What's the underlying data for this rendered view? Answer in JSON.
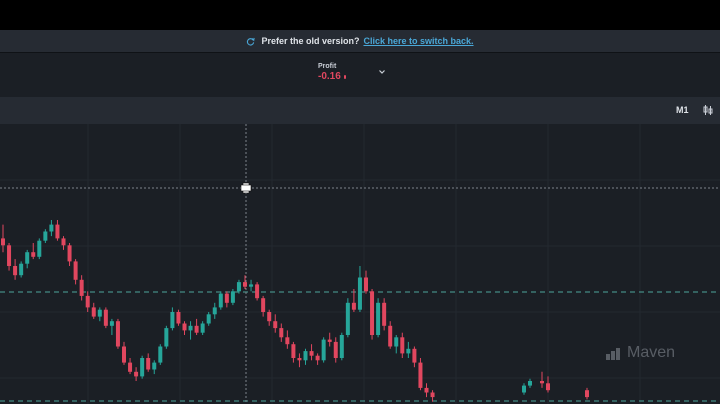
{
  "notice": {
    "text": "Prefer the old version?",
    "link": "Click here to switch back."
  },
  "profit": {
    "label": "Profit",
    "value": "-0.16",
    "color": "#e1475f"
  },
  "toolbar": {
    "timeframe": "M1"
  },
  "watermark": {
    "text": "Maven"
  },
  "colors": {
    "up": "#26a69a",
    "down": "#e1475f",
    "background": "#1b1f25",
    "grid": "#232830",
    "dashed_level": "#4ea59a"
  },
  "chart_data": {
    "type": "candlestick",
    "candles": [
      [
        0.72,
        0.78,
        0.66,
        0.69
      ],
      [
        0.69,
        0.7,
        0.58,
        0.6
      ],
      [
        0.6,
        0.63,
        0.54,
        0.56
      ],
      [
        0.56,
        0.62,
        0.55,
        0.61
      ],
      [
        0.61,
        0.67,
        0.59,
        0.66
      ],
      [
        0.66,
        0.7,
        0.63,
        0.64
      ],
      [
        0.64,
        0.72,
        0.63,
        0.71
      ],
      [
        0.71,
        0.76,
        0.7,
        0.75
      ],
      [
        0.75,
        0.8,
        0.73,
        0.78
      ],
      [
        0.78,
        0.8,
        0.71,
        0.72
      ],
      [
        0.72,
        0.73,
        0.67,
        0.69
      ],
      [
        0.69,
        0.7,
        0.6,
        0.62
      ],
      [
        0.62,
        0.63,
        0.52,
        0.54
      ],
      [
        0.54,
        0.56,
        0.45,
        0.47
      ],
      [
        0.47,
        0.49,
        0.4,
        0.42
      ],
      [
        0.42,
        0.44,
        0.37,
        0.38
      ],
      [
        0.38,
        0.42,
        0.36,
        0.41
      ],
      [
        0.41,
        0.42,
        0.33,
        0.34
      ],
      [
        0.34,
        0.37,
        0.3,
        0.36
      ],
      [
        0.36,
        0.37,
        0.24,
        0.25
      ],
      [
        0.25,
        0.27,
        0.17,
        0.18
      ],
      [
        0.18,
        0.2,
        0.13,
        0.14
      ],
      [
        0.14,
        0.16,
        0.1,
        0.12
      ],
      [
        0.12,
        0.21,
        0.11,
        0.2
      ],
      [
        0.2,
        0.22,
        0.14,
        0.15
      ],
      [
        0.15,
        0.19,
        0.13,
        0.18
      ],
      [
        0.18,
        0.26,
        0.17,
        0.25
      ],
      [
        0.25,
        0.34,
        0.24,
        0.33
      ],
      [
        0.33,
        0.42,
        0.32,
        0.4
      ],
      [
        0.4,
        0.41,
        0.34,
        0.35
      ],
      [
        0.35,
        0.36,
        0.3,
        0.32
      ],
      [
        0.32,
        0.36,
        0.28,
        0.34
      ],
      [
        0.34,
        0.37,
        0.3,
        0.31
      ],
      [
        0.31,
        0.36,
        0.3,
        0.35
      ],
      [
        0.35,
        0.4,
        0.34,
        0.39
      ],
      [
        0.39,
        0.44,
        0.37,
        0.42
      ],
      [
        0.42,
        0.49,
        0.41,
        0.48
      ],
      [
        0.48,
        0.49,
        0.42,
        0.44
      ],
      [
        0.44,
        0.5,
        0.43,
        0.49
      ],
      [
        0.49,
        0.54,
        0.48,
        0.53
      ],
      [
        0.53,
        0.56,
        0.5,
        0.51
      ],
      [
        0.51,
        0.54,
        0.49,
        0.52
      ],
      [
        0.52,
        0.53,
        0.45,
        0.46
      ],
      [
        0.46,
        0.47,
        0.38,
        0.4
      ],
      [
        0.4,
        0.41,
        0.34,
        0.36
      ],
      [
        0.36,
        0.39,
        0.31,
        0.33
      ],
      [
        0.33,
        0.35,
        0.27,
        0.29
      ],
      [
        0.29,
        0.32,
        0.24,
        0.26
      ],
      [
        0.26,
        0.27,
        0.18,
        0.2
      ],
      [
        0.2,
        0.22,
        0.16,
        0.19
      ],
      [
        0.19,
        0.24,
        0.17,
        0.23
      ],
      [
        0.23,
        0.26,
        0.19,
        0.21
      ],
      [
        0.21,
        0.22,
        0.17,
        0.19
      ],
      [
        0.19,
        0.29,
        0.18,
        0.28
      ],
      [
        0.28,
        0.31,
        0.25,
        0.27
      ],
      [
        0.27,
        0.29,
        0.18,
        0.2
      ],
      [
        0.2,
        0.31,
        0.19,
        0.3
      ],
      [
        0.3,
        0.46,
        0.29,
        0.44
      ],
      [
        0.44,
        0.5,
        0.4,
        0.41
      ],
      [
        0.41,
        0.6,
        0.4,
        0.55
      ],
      [
        0.55,
        0.58,
        0.48,
        0.49
      ],
      [
        0.49,
        0.5,
        0.28,
        0.3
      ],
      [
        0.3,
        0.46,
        0.29,
        0.44
      ],
      [
        0.44,
        0.46,
        0.32,
        0.34
      ],
      [
        0.34,
        0.36,
        0.24,
        0.25
      ],
      [
        0.25,
        0.3,
        0.22,
        0.29
      ],
      [
        0.29,
        0.31,
        0.2,
        0.22
      ],
      [
        0.22,
        0.27,
        0.2,
        0.24
      ],
      [
        0.24,
        0.25,
        0.16,
        0.18
      ],
      [
        0.18,
        0.2,
        0.06,
        0.07
      ],
      [
        0.07,
        0.09,
        0.03,
        0.05
      ],
      [
        0.05,
        0.06,
        0.01,
        0.03
      ]
    ],
    "extra_candles_right": [
      [
        0.05,
        0.09,
        0.04,
        0.08
      ],
      [
        0.08,
        0.11,
        0.07,
        0.1
      ],
      [
        0.1,
        0.14,
        0.07,
        0.09
      ],
      [
        0.09,
        0.12,
        0.05,
        0.06
      ],
      [
        0.06,
        0.07,
        0.02,
        0.03
      ]
    ]
  }
}
